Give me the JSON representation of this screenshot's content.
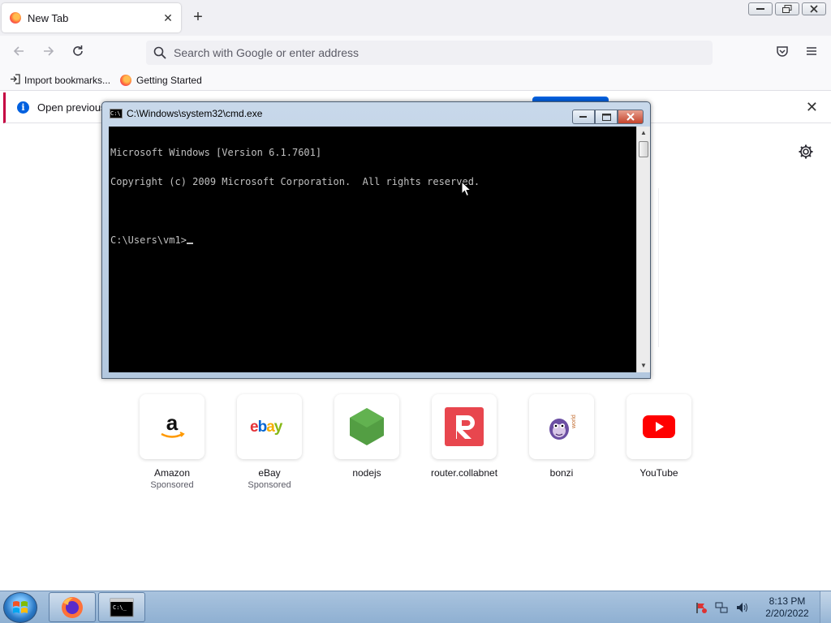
{
  "browser": {
    "tab_title": "New Tab",
    "tab_close": "✕",
    "new_tab_symbol": "+",
    "url_placeholder": "Search with Google or enter address",
    "bookmarks": [
      {
        "label": "Import bookmarks...",
        "icon": "import-icon"
      },
      {
        "label": "Getting Started",
        "icon": "firefox-icon"
      }
    ],
    "notification_text": "Open previous",
    "notification_close": "✕"
  },
  "top_sites": [
    {
      "name": "Amazon",
      "sponsored": "Sponsored",
      "icon": "amazon-logo"
    },
    {
      "name": "eBay",
      "sponsored": "Sponsored",
      "icon": "ebay-logo"
    },
    {
      "name": "nodejs",
      "sponsored": "",
      "icon": "nodejs-logo"
    },
    {
      "name": "router.collabnet",
      "sponsored": "",
      "icon": "r-logo"
    },
    {
      "name": "bonzi",
      "sponsored": "",
      "icon": "bonzi-logo"
    },
    {
      "name": "YouTube",
      "sponsored": "",
      "icon": "youtube-logo"
    }
  ],
  "cmd_window": {
    "title": "C:\\Windows\\system32\\cmd.exe",
    "lines": [
      "Microsoft Windows [Version 6.1.7601]",
      "Copyright (c) 2009 Microsoft Corporation.  All rights reserved.",
      "",
      "C:\\Users\\vm1>"
    ]
  },
  "taskbar": {
    "time": "8:13 PM",
    "date": "2/20/2022",
    "apps": [
      "firefox",
      "cmd"
    ]
  },
  "colors": {
    "accent": "#0060df",
    "notice_border": "#c50042",
    "taskbar": "#a9c3de"
  }
}
